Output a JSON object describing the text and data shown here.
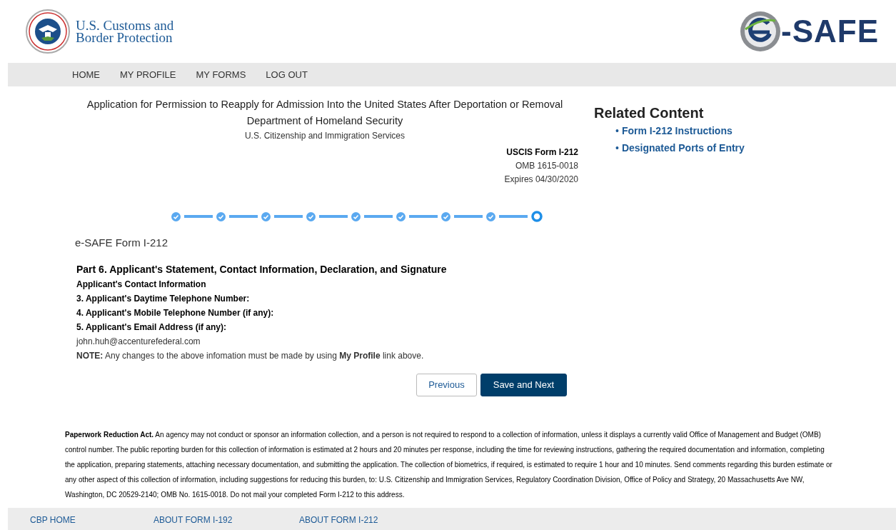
{
  "header": {
    "agency_name": [
      "U.S. Customs and",
      "Border Protection"
    ],
    "app_logo_text": "-SAFE"
  },
  "nav": [
    {
      "label": "HOME"
    },
    {
      "label": "MY PROFILE"
    },
    {
      "label": "MY FORMS"
    },
    {
      "label": "LOG OUT"
    }
  ],
  "form_header": {
    "title": "Application for Permission to Reapply for Admission Into the United States After Deportation or Removal",
    "department": "Department of Homeland Security",
    "agency": "U.S. Citizenship and Immigration Services",
    "form_number": "USCIS Form I-212",
    "omb": "OMB 1615-0018",
    "expires": "Expires 04/30/2020"
  },
  "related_content": {
    "title": "Related Content",
    "links": [
      {
        "bullet": "•",
        "label": "Form I-212 Instructions"
      },
      {
        "bullet": "•",
        "label": "Designated Ports of Entry"
      }
    ]
  },
  "steps": [
    {
      "completed": true
    },
    {
      "completed": true
    },
    {
      "completed": true
    },
    {
      "completed": true
    },
    {
      "completed": true
    },
    {
      "completed": true
    },
    {
      "completed": true
    },
    {
      "completed": true
    },
    {
      "completed": false
    }
  ],
  "form_name": "e-SAFE Form I-212",
  "section": {
    "title": "Part 6. Applicant's Statement, Contact Information, Declaration, and Signature",
    "subtitle": "Applicant's Contact Information",
    "lines": [
      {
        "kind": "label",
        "text": "3. Applicant's Daytime Telephone Number:"
      },
      {
        "kind": "label",
        "text": "4. Applicant's Mobile Telephone Number (if any):"
      },
      {
        "kind": "label",
        "text": "5. Applicant's Email Address (if any):"
      },
      {
        "kind": "value",
        "text": "john.huh@accenturefederal.com"
      },
      {
        "kind": "note",
        "text": "**NOTE:** Any changes to the above infomation must be made by using **My Profile** link above."
      }
    ]
  },
  "buttons": [
    {
      "kind": "secondary",
      "label": "Previous"
    },
    {
      "kind": "primary",
      "label": "Save and Next"
    }
  ],
  "paperwork_notice": "**Paperwork Reduction Act.**  An agency may not conduct or sponsor an information collection, and a person is not required to respond to a collection of information, unless it displays a currently valid Office of Management and Budget (OMB) control number.  The public reporting burden for this collection of information is estimated at 2 hours and 20 minutes per response, including the time for reviewing instructions, gathering the required documentation and information, completing the application, preparing statements, attaching necessary documentation, and submitting the application.  The collection of biometrics, if required, is estimated to require 1 hour and 10 minutes.  Send comments regarding this burden estimate or any other aspect of this collection of information, including suggestions for reducing this burden, to:  U.S. Citizenship and Immigration Services, Regulatory Coordination Division, Office of Policy and Strategy, 20 Massachusetts Ave NW, Washington, DC 20529-2140; OMB No. 1615-0018.  Do not mail your completed Form I-212 to this address.",
  "footer_links": [
    {
      "label": "CBP HOME"
    },
    {
      "label": "ABOUT FORM I-192"
    },
    {
      "label": "ABOUT FORM I-212"
    }
  ]
}
